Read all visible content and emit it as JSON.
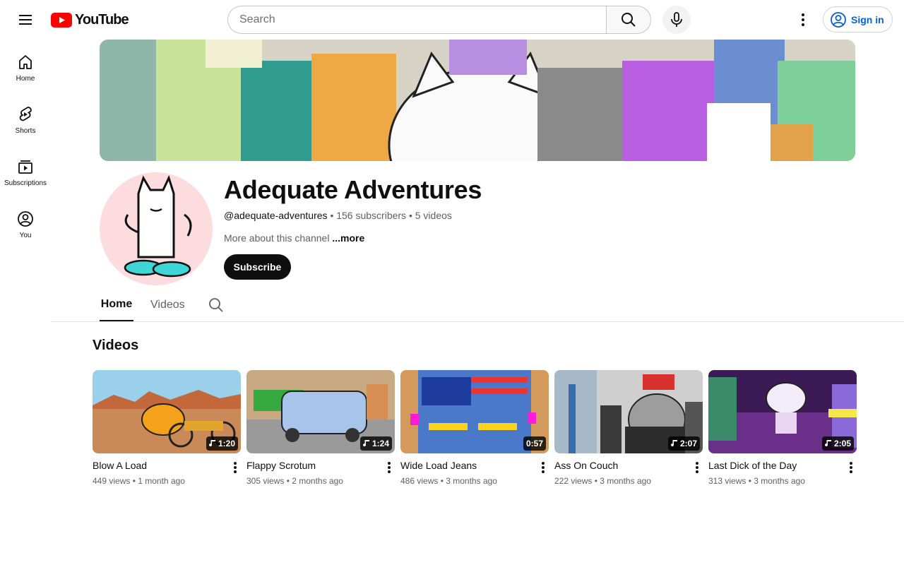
{
  "header": {
    "logo_text": "YouTube",
    "search_placeholder": "Search",
    "sign_in_label": "Sign in"
  },
  "sidebar": {
    "items": [
      {
        "label": "Home",
        "icon": "home-icon"
      },
      {
        "label": "Shorts",
        "icon": "shorts-icon"
      },
      {
        "label": "Subscriptions",
        "icon": "subscriptions-icon"
      },
      {
        "label": "You",
        "icon": "you-icon"
      }
    ]
  },
  "channel": {
    "name": "Adequate Adventures",
    "handle": "@adequate-adventures",
    "subscribers": "156 subscribers",
    "video_count": "5 videos",
    "about": "More about this channel",
    "about_more": "...more",
    "subscribe_label": "Subscribe"
  },
  "tabs": {
    "home": "Home",
    "videos": "Videos"
  },
  "section": {
    "title": "Videos"
  },
  "videos": [
    {
      "title": "Blow A Load",
      "duration": "1:20",
      "views": "449 views",
      "age": "1 month ago"
    },
    {
      "title": "Flappy Scrotum",
      "duration": "1:24",
      "views": "305 views",
      "age": "2 months ago"
    },
    {
      "title": "Wide Load Jeans",
      "duration": "0:57",
      "views": "486 views",
      "age": "3 months ago"
    },
    {
      "title": "Ass On Couch",
      "duration": "2:07",
      "views": "222 views",
      "age": "3 months ago"
    },
    {
      "title": "Last Dick of the Day",
      "duration": "2:05",
      "views": "313 views",
      "age": "3 months ago"
    }
  ],
  "colors": {
    "brand_red": "#ff0000",
    "link_blue": "#065fd4",
    "text_primary": "#0f0f0f",
    "text_secondary": "#606060"
  }
}
